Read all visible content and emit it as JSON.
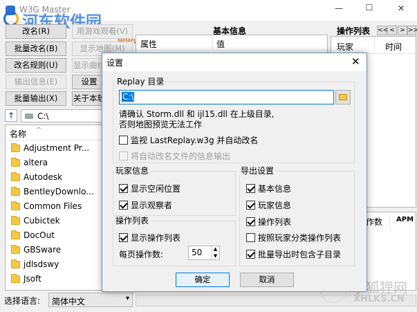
{
  "window": {
    "title": "W3G Master",
    "min": "—",
    "max": "☐",
    "close": "✕"
  },
  "toolbar": {
    "rename": "改名(R)",
    "replay_observer": "用游戏观看(V)",
    "batch_rename": "批量改名(B)",
    "show_map": "显示地图(M)",
    "rename_rules": "改名规则(U)",
    "show_curve": "显示曲线",
    "export_info": "输出信息(E)",
    "settings": "设置",
    "batch_export": "批量输出(X)",
    "about": "关于本软"
  },
  "path": {
    "value": "C:\\",
    "up": "↑"
  },
  "filelist": {
    "header": "名称",
    "items": [
      "Adjustment Pr...",
      "altera",
      "Autodesk",
      "BentleyDownlo...",
      "Common Files",
      "Cubictek",
      "DocOut",
      "GBSware",
      "jdlsdswy",
      "Jsoft"
    ]
  },
  "info": {
    "title": "基本信息",
    "col_attr": "属性",
    "col_value": "值"
  },
  "ops": {
    "title": "操作列表",
    "col_player": "玩家",
    "col_time": "时间",
    "col_opcount": "作数",
    "col_apm": "APM",
    "nav": [
      "<<",
      "<",
      ">",
      ">>"
    ]
  },
  "bottom": {
    "language_label": "选择语言:",
    "language_value": "简体中文"
  },
  "watermarks": {
    "top": "河东软件园",
    "url": "www.pc0359.cn",
    "bottom_cn": "小狐狸网",
    "bottom_en": "XHLKS.CN"
  },
  "dialog": {
    "title": "设置",
    "replay_dir_group": "Replay 目录",
    "replay_dir_value": "C:\\",
    "note_line1": "请确认 Storm.dll 和 ijl15.dll 在上级目录,",
    "note_line2": "否则地图预览无法工作",
    "monitor": "监视 LastReplay.w3g 并自动改名",
    "auto_export": "将自动改名文件的信息输出",
    "player_info_group": "玩家信息",
    "show_idle": "显示空闲位置",
    "show_observers": "显示观察者",
    "ops_group": "操作列表",
    "show_ops": "显示操作列表",
    "per_page_label": "每页操作数:",
    "per_page_value": "50",
    "export_group": "导出设置",
    "export_basic": "基本信息",
    "export_player": "玩家信息",
    "export_ops": "操作列表",
    "export_by_player": "按照玩家分类操作列表",
    "export_subdir": "批量导出时包含子目录",
    "ok": "确定",
    "cancel": "取消",
    "checks": {
      "monitor": false,
      "auto_export": false,
      "show_idle": true,
      "show_observers": true,
      "show_ops": true,
      "export_basic": true,
      "export_player": true,
      "export_ops": true,
      "export_by_player": false,
      "export_subdir": true
    }
  }
}
